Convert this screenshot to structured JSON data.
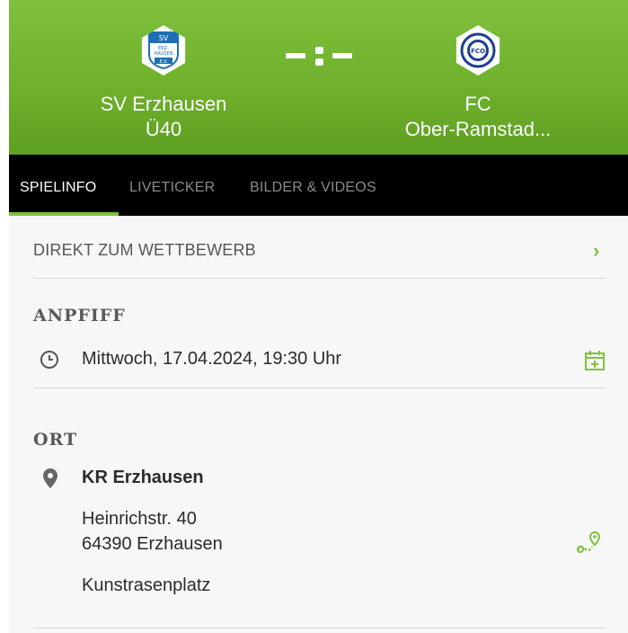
{
  "header": {
    "home_team": {
      "name_line1": "SV Erzhausen",
      "name_line2": "Ü40",
      "crest_text": [
        "SV",
        "ERZ-",
        "HAUSEN",
        "E.V."
      ]
    },
    "away_team": {
      "name_line1": "FC",
      "name_line2": "Ober-Ramstad...",
      "crest_text": "FCO"
    },
    "score_display": "-:-"
  },
  "tabs": [
    {
      "label": "SPIELINFO",
      "active": true
    },
    {
      "label": "LIVETICKER",
      "active": false
    },
    {
      "label": "BILDER & VIDEOS",
      "active": false
    }
  ],
  "competition_link": {
    "label": "DIREKT ZUM WETTBEWERB",
    "chevron": "›"
  },
  "kickoff": {
    "title": "ANPFIFF",
    "datetime": "Mittwoch, 17.04.2024, 19:30 Uhr",
    "clock_icon": "clock-icon",
    "calendar_icon": "calendar-add-icon"
  },
  "venue": {
    "title": "ORT",
    "name": "KR Erzhausen",
    "street": "Heinrichstr. 40",
    "city": "64390 Erzhausen",
    "surface": "Kunstrasenplatz",
    "pin_icon": "location-pin-icon",
    "map_icon": "map-route-icon"
  },
  "colors": {
    "accent": "#7fc13d",
    "tabbar": "#000000",
    "background": "#f7f7f7"
  }
}
